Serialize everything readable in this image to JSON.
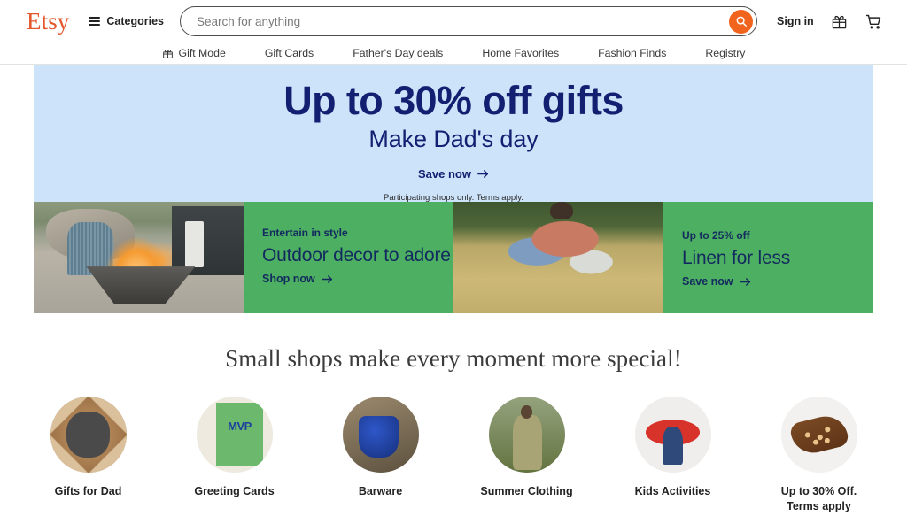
{
  "header": {
    "logo": "Etsy",
    "categories_label": "Categories",
    "search": {
      "placeholder": "Search for anything",
      "value": "",
      "icon": "search-icon"
    },
    "sign_in": "Sign in",
    "gift_icon": "gift-icon",
    "cart_icon": "cart-icon"
  },
  "subnav": {
    "items": [
      {
        "label": "Gift Mode",
        "icon": "gift-icon"
      },
      {
        "label": "Gift Cards",
        "icon": null
      },
      {
        "label": "Father's Day deals",
        "icon": null
      },
      {
        "label": "Home Favorites",
        "icon": null
      },
      {
        "label": "Fashion Finds",
        "icon": null
      },
      {
        "label": "Registry",
        "icon": null
      }
    ]
  },
  "hero": {
    "headline": "Up to 30% off gifts",
    "subhead": "Make Dad's day",
    "cta": "Save now",
    "terms": "Participating shops only. Terms apply.",
    "bg_color": "#cde3fa",
    "text_color": "#132072"
  },
  "promos": [
    {
      "eyebrow": "Entertain in style",
      "title": "Outdoor decor to adore",
      "cta": "Shop now",
      "image_alt": "outdoor-firepit-photo",
      "bg_color": "#4caf62"
    },
    {
      "eyebrow": "Up to 25% off",
      "title": "Linen for less",
      "cta": "Save now",
      "image_alt": "linen-field-photo",
      "bg_color": "#4caf62"
    }
  ],
  "shops": {
    "heading": "Small shops make every moment more special!",
    "categories": [
      {
        "label": "Gifts for Dad",
        "image_alt": "gift-box-photo"
      },
      {
        "label": "Greeting Cards",
        "image_alt": "most-valuable-dad-card-photo"
      },
      {
        "label": "Barware",
        "image_alt": "blue-barware-photo"
      },
      {
        "label": "Summer Clothing",
        "image_alt": "summer-linen-outfit-photo"
      },
      {
        "label": "Kids Activities",
        "image_alt": "ladybug-kids-craft-photo"
      },
      {
        "label": "Up to 30% Off. Terms apply",
        "image_alt": "wooden-serving-board-photo"
      }
    ]
  },
  "colors": {
    "brand_orange": "#f1641e",
    "logo_orange": "#e4572d",
    "hero_blue": "#cde3fa",
    "hero_navy": "#132072",
    "promo_green": "#4caf62",
    "promo_navy": "#132a5e"
  }
}
